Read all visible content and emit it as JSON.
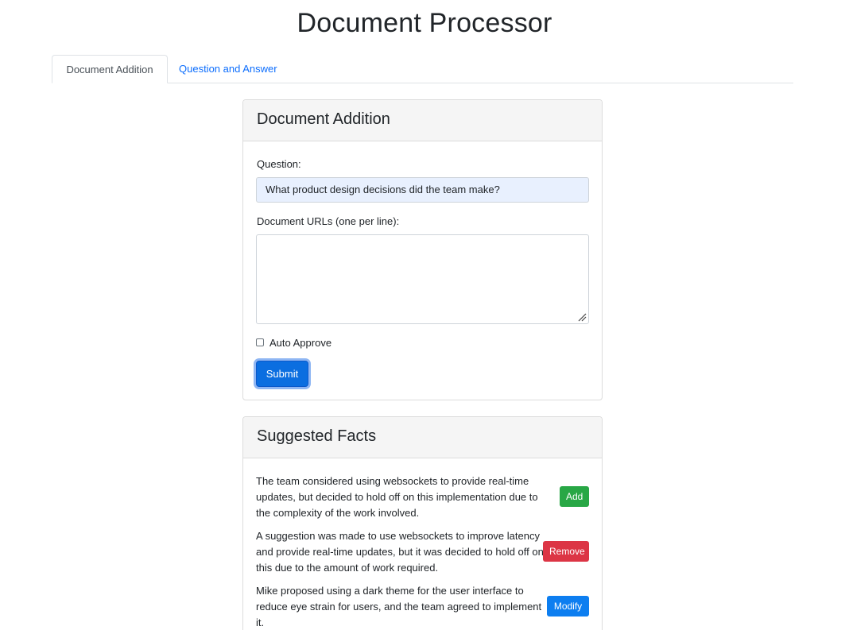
{
  "page": {
    "title": "Document Processor"
  },
  "tabs": [
    {
      "label": "Document Addition",
      "active": true
    },
    {
      "label": "Question and Answer",
      "active": false
    }
  ],
  "document_addition": {
    "header": "Document Addition",
    "question_label": "Question:",
    "question_value": "What product design decisions did the team make?",
    "urls_label": "Document URLs (one per line):",
    "urls_value": "",
    "auto_approve_label": "Auto Approve",
    "auto_approve_checked": false,
    "submit_label": "Submit"
  },
  "suggested_facts": {
    "header": "Suggested Facts",
    "items": [
      {
        "text": "The team considered using websockets to provide real-time updates, but decided to hold off on this implementation due to the complexity of the work involved.",
        "action": "Add",
        "action_color": "#28a745"
      },
      {
        "text": "A suggestion was made to use websockets to improve latency and provide real-time updates, but it was decided to hold off on this due to the amount of work required.",
        "action": "Remove",
        "action_color": "#dc3545"
      },
      {
        "text": "Mike proposed using a dark theme for the user interface to reduce eye strain for users, and the team agreed to implement it.",
        "action": "Modify",
        "action_color": "#0d7ef0"
      }
    ]
  },
  "colors": {
    "accent": "#0b6ee0",
    "link": "#0d6efd",
    "input_autofill_bg": "#e8f0fe"
  }
}
